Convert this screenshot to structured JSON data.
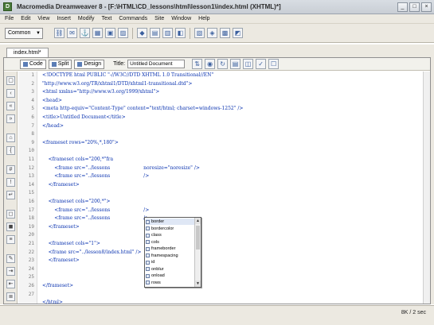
{
  "window": {
    "title": "Macromedia Dreamweaver 8 - [F:\\HTML\\CD_lessons\\html\\lesson1\\index.html (XHTML)*]",
    "controls": [
      "_",
      "□",
      "×"
    ]
  },
  "menubar": [
    "File",
    "Edit",
    "View",
    "Insert",
    "Modify",
    "Text",
    "Commands",
    "Site",
    "Window",
    "Help"
  ],
  "insertbar": {
    "category": "Common",
    "icons": [
      "hyperlink-icon",
      "email-link-icon",
      "named-anchor-icon",
      "table-icon",
      "layer-icon",
      "images-icon",
      "media-icon",
      "date-icon",
      "server-include-icon",
      "comment-icon",
      "head-icon",
      "script-icon",
      "template-icon",
      "tag-chooser-icon"
    ]
  },
  "document": {
    "tab": "index.html*",
    "views": {
      "code": "Code",
      "split": "Split",
      "design": "Design"
    },
    "title_label": "Title:",
    "title_value": "Untitled Document",
    "lines": [
      "<!DOCTYPE html PUBLIC \"-//W3C//DTD XHTML 1.0 Transitional//EN\"",
      "\"http://www.w3.org/TR/xhtml1/DTD/xhtml1-transitional.dtd\">",
      "<html xmlns=\"http://www.w3.org/1999/xhtml\">",
      "<head>",
      "<meta http-equiv=\"Content-Type\" content=\"text/html; charset=windows-1252\" />",
      "<title>Untitled Document</title>",
      "</head>",
      "",
      "<frameset rows=\"20%,*,180\">",
      "",
      "    <frameset cols=\"200,*\"fra",
      "        <frame src=\"../lessons                      noresize=\"noresize\" />",
      "        <frame src=\"../lessons                      />",
      "    </frameset>",
      "",
      "    <frameset cols=\"200,*\">",
      "        <frame src=\"../lessons                      />",
      "        <frame src=\"../lessons                      />",
      "    </frameset>",
      "",
      "    <frameset cols=\"1\">",
      "    <frame src=\"../lesson8/index.html\" />",
      "    </frameset>",
      "",
      "",
      "</frameset>",
      "",
      "</html>"
    ],
    "line_numbers": [
      "1",
      "2",
      "3",
      "4",
      "5",
      "6",
      "7",
      "8",
      "9",
      "10",
      "11",
      "12",
      "13",
      "14",
      "15",
      "16",
      "17",
      "18",
      "19",
      "20",
      "21",
      "22",
      "23",
      "24",
      "25",
      "26",
      "27"
    ]
  },
  "code_hint_popup": {
    "items": [
      "border",
      "bordercolor",
      "class",
      "cols",
      "frameborder",
      "framespacing",
      "id",
      "onblur",
      "onload",
      "rows"
    ],
    "selected": "border"
  },
  "status": {
    "left": "",
    "right": "8K / 2 sec"
  }
}
